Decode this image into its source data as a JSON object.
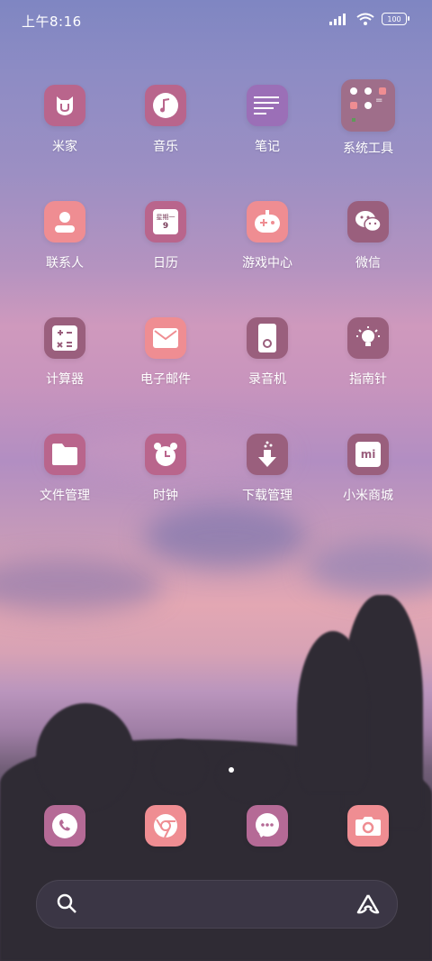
{
  "status_bar": {
    "time": "上午8:16",
    "battery": "100"
  },
  "apps": [
    {
      "label": "米家",
      "icon": "mi-home-icon",
      "color": "#b9658c"
    },
    {
      "label": "音乐",
      "icon": "music-icon",
      "color": "#b9658c"
    },
    {
      "label": "笔记",
      "icon": "notes-icon",
      "color": "#9b6fb7"
    },
    {
      "label": "系统工具",
      "icon": "folder-icon",
      "color": "#9f6e8a"
    },
    {
      "label": "联系人",
      "icon": "contacts-icon",
      "color": "#ef8d92"
    },
    {
      "label": "日历",
      "icon": "calendar-icon",
      "color": "#b9658c",
      "calendar_weekday": "星期一",
      "calendar_day": "9"
    },
    {
      "label": "游戏中心",
      "icon": "game-icon",
      "color": "#ef8d92"
    },
    {
      "label": "微信",
      "icon": "wechat-icon",
      "color": "#9a5f7d"
    },
    {
      "label": "计算器",
      "icon": "calculator-icon",
      "color": "#9a5f7d"
    },
    {
      "label": "电子邮件",
      "icon": "mail-icon",
      "color": "#ef8d92"
    },
    {
      "label": "录音机",
      "icon": "recorder-icon",
      "color": "#9a5f7d"
    },
    {
      "label": "指南针",
      "icon": "lightbulb-icon",
      "color": "#9a5f7d"
    },
    {
      "label": "文件管理",
      "icon": "files-icon",
      "color": "#b9658c"
    },
    {
      "label": "时钟",
      "icon": "clock-icon",
      "color": "#b9658c"
    },
    {
      "label": "下载管理",
      "icon": "download-icon",
      "color": "#9a5f7d"
    },
    {
      "label": "小米商城",
      "icon": "mi-store-icon",
      "color": "#9a5f7d"
    }
  ],
  "folder_preview": {
    "mini_label": "="
  },
  "store_mark": "mi",
  "dock": [
    {
      "icon": "phone-icon",
      "color": "#b56a96"
    },
    {
      "icon": "browser-icon",
      "color": "#ef8d92"
    },
    {
      "icon": "messages-icon",
      "color": "#b56a96"
    },
    {
      "icon": "camera-icon",
      "color": "#ef8d92"
    }
  ],
  "search_bar": {
    "left_icon": "search-icon",
    "right_icon": "assistant-icon"
  }
}
